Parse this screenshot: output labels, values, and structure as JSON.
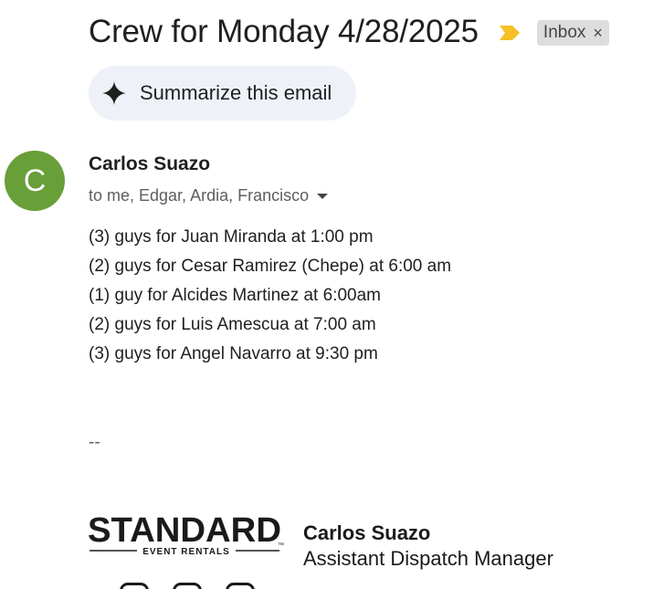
{
  "email": {
    "subject": "Crew for Monday 4/28/2025",
    "label": "Inbox",
    "label_remove": "×",
    "summarize_label": "Summarize this email",
    "sender": {
      "initial": "C",
      "name": "Carlos Suazo",
      "avatar_color": "#689f38",
      "recipients": "to me, Edgar, Ardia, Francisco"
    },
    "body_lines": [
      "(3) guys for Juan Miranda at 1:00 pm",
      "(2) guys for Cesar Ramirez (Chepe) at 6:00 am",
      "(1) guy for Alcides Martinez at 6:00am",
      "(2) guys for Luis Amescua at 7:00 am",
      "(3) guys for Angel Navarro at 9:30 pm"
    ],
    "signature": {
      "separator": "--",
      "logo_text": "STANDARD",
      "logo_subtext": "EVENT RENTALS",
      "logo_tm": "™",
      "name": "Carlos Suazo",
      "title": "Assistant Dispatch Manager",
      "social_icons": [
        "instagram-icon",
        "facebook-icon",
        "linkedin-icon"
      ]
    }
  },
  "colors": {
    "importance_marker": "#f6c026",
    "label_chip_bg": "#dddddd",
    "summarize_bg": "#eef2f8"
  },
  "icons": {
    "importance": "importance-marker-icon",
    "summarize": "sparkle-icon",
    "recipients_toggle": "chevron-down-icon"
  }
}
